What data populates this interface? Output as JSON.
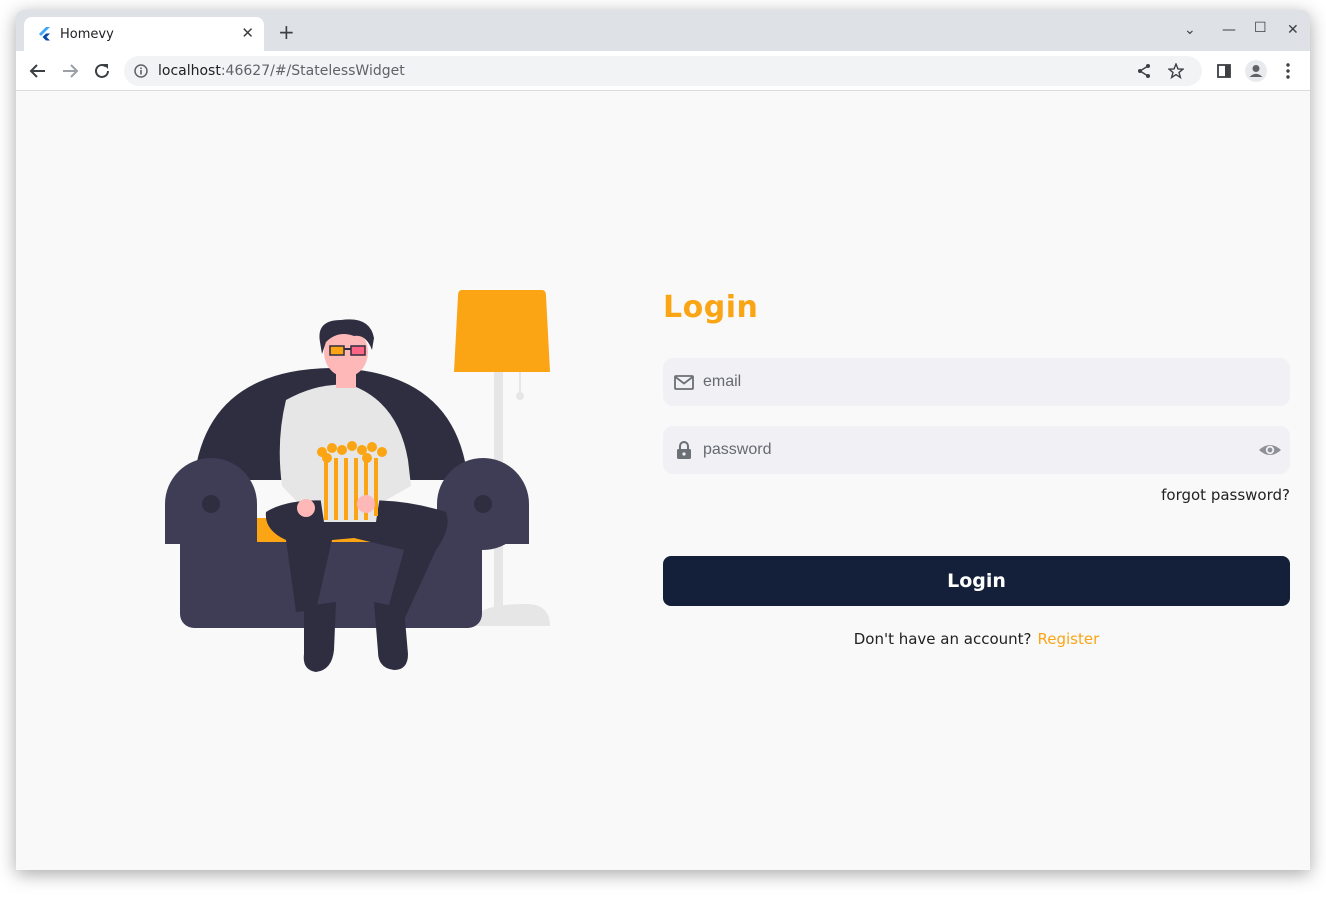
{
  "browser": {
    "tab_title": "Homevy",
    "url_host": "localhost",
    "url_rest": ":46627/#/StatelessWidget",
    "icons": {
      "tab_favicon": "flutter-icon",
      "tab_close": "close-icon",
      "new_tab": "plus-icon",
      "tab_search": "chevron-down-icon",
      "minimize": "minimize-icon",
      "maximize": "maximize-icon",
      "close_window": "close-window-icon",
      "back": "back-arrow-icon",
      "forward": "forward-arrow-icon",
      "reload": "reload-icon",
      "site_info": "info-icon",
      "share": "share-icon",
      "bookmark": "star-icon",
      "side_panel": "side-panel-icon",
      "profile": "profile-icon",
      "menu": "more-vert-icon"
    },
    "glyphs": {
      "tab_close": "✕",
      "new_tab": "+",
      "tab_search": "⌄",
      "minimize": "—",
      "maximize": "☐",
      "close_window": "✕"
    }
  },
  "login": {
    "title": "Login",
    "email_placeholder": "email",
    "password_placeholder": "password",
    "forgot_password": "forgot password?",
    "login_button": "Login",
    "no_account_text": "Don't have an account?",
    "register_link": "Register",
    "icons": {
      "email": "mail-icon",
      "password": "lock-icon",
      "visibility": "eye-icon"
    }
  },
  "colors": {
    "accent": "#f9a516",
    "button": "#14203a",
    "field_bg": "#f0f0f5",
    "page_bg": "#f9f9f9"
  }
}
